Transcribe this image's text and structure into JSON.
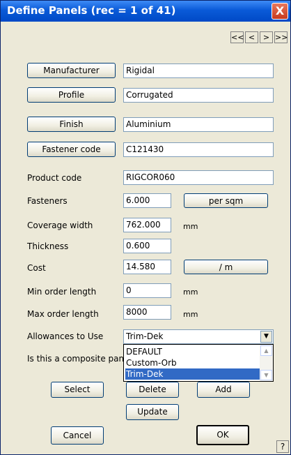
{
  "window": {
    "title": "Define Panels (rec = 1 of 41)",
    "close_glyph": "X"
  },
  "nav": {
    "first": "<<",
    "prev": "<",
    "next": ">",
    "last": ">>"
  },
  "fields": {
    "manufacturer": {
      "label": "Manufacturer",
      "value": "Rigidal"
    },
    "profile": {
      "label": "Profile",
      "value": "Corrugated"
    },
    "finish": {
      "label": "Finish",
      "value": "Aluminium"
    },
    "fastener_code": {
      "label": "Fastener code",
      "value": "C121430"
    },
    "product_code": {
      "label": "Product code",
      "value": "RIGCOR060"
    },
    "fasteners": {
      "label": "Fasteners",
      "value": "6.000",
      "unit_button": "per sqm"
    },
    "coverage_width": {
      "label": "Coverage width",
      "value": "762.000",
      "unit": "mm"
    },
    "thickness": {
      "label": "Thickness",
      "value": "0.600"
    },
    "cost": {
      "label": "Cost",
      "value": "14.580",
      "unit_button": "/ m"
    },
    "min_order_length": {
      "label": "Min order length",
      "value": "0",
      "unit": "mm"
    },
    "max_order_length": {
      "label": "Max order length",
      "value": "8000",
      "unit": "mm"
    },
    "allowances": {
      "label": "Allowances to Use",
      "value": "Trim-Dek",
      "options": [
        "DEFAULT",
        "Custom-Orb",
        "Trim-Dek"
      ]
    },
    "composite": {
      "label": "Is this a composite pan"
    }
  },
  "buttons": {
    "select": "Select",
    "delete": "Delete",
    "add": "Add",
    "update": "Update",
    "cancel": "Cancel",
    "ok": "OK",
    "help": "?"
  },
  "glyphs": {
    "dropdown": "▼",
    "scroll_up": "▲",
    "scroll_down": "▼"
  },
  "colors": {
    "titlebar": "#0a5ad8",
    "dialog_bg": "#ece9d8",
    "selection": "#316ac5",
    "close": "#d9502f"
  }
}
